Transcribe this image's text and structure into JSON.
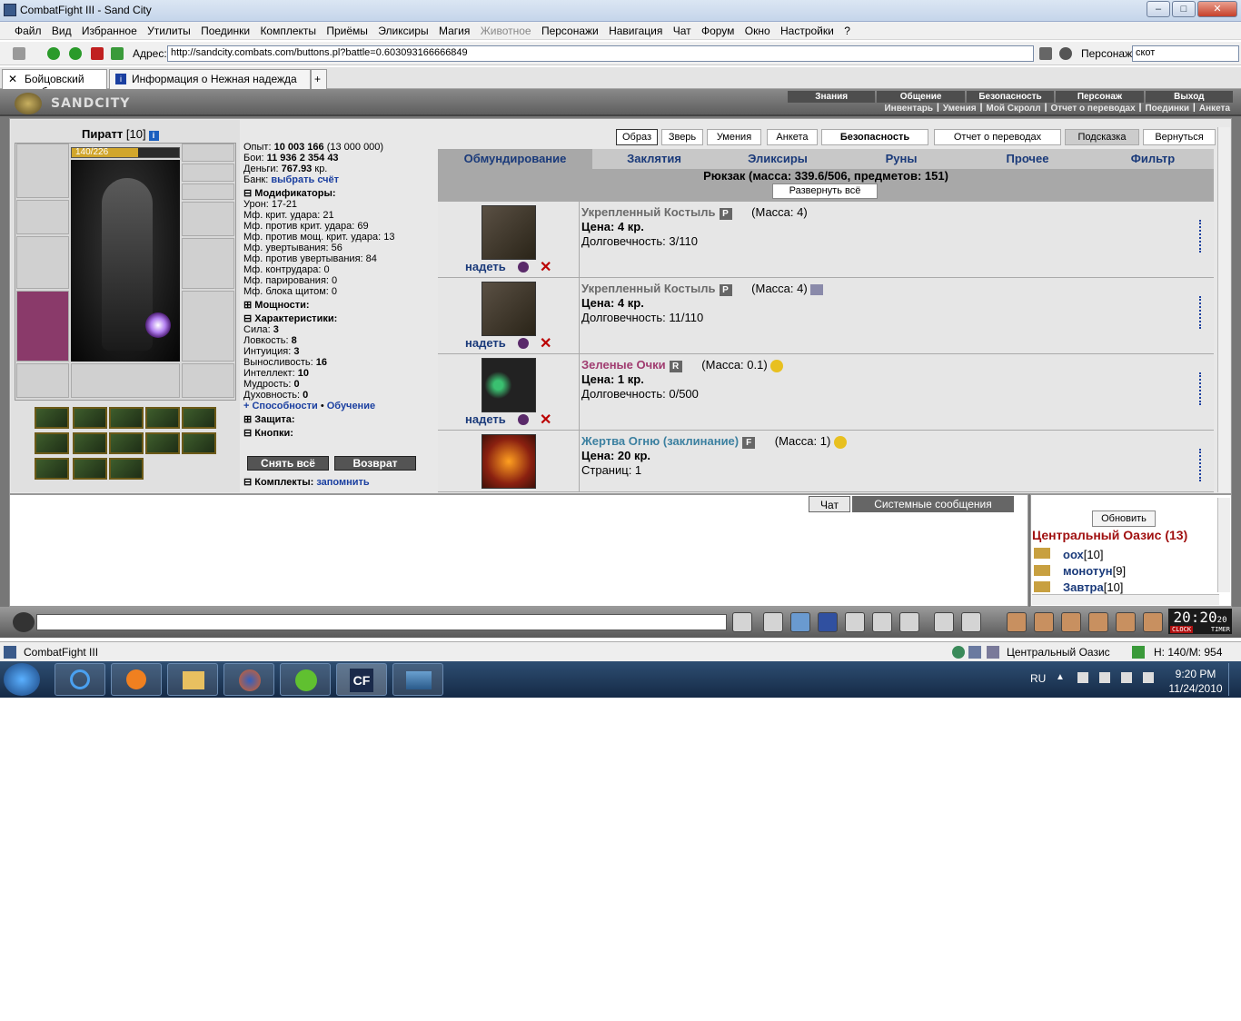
{
  "window": {
    "title": "CombatFight III - Sand City"
  },
  "menu": [
    "Файл",
    "Вид",
    "Избранное",
    "Утилиты",
    "Поединки",
    "Комплекты",
    "Приёмы",
    "Эликсиры",
    "Магия",
    "Животное",
    "Персонажи",
    "Навигация",
    "Чат",
    "Форум",
    "Окно",
    "Настройки",
    "?"
  ],
  "address": {
    "label": "Адрес:",
    "url": "http://sandcity.combats.com/buttons.pl?battle=0.603093166666849",
    "persona_label": "Персонаж:",
    "persona_value": "скот"
  },
  "tabs": [
    {
      "label": "Бойцовский клуб"
    },
    {
      "label": "Информация о Нежная надежда"
    }
  ],
  "header": {
    "logo": "SANDCITY",
    "nav_top": [
      "Знания",
      "Общение",
      "Безопасность",
      "Персонаж",
      "Выход"
    ],
    "nav_bottom": [
      "Инвентарь",
      "Умения",
      "Мой Скролл",
      "Отчет о переводах",
      "Поединки",
      "Анкета"
    ]
  },
  "character": {
    "name": "Пиратт",
    "level": "[10]",
    "hp": "140/226",
    "hp_fraction": 0.62
  },
  "stats": {
    "exp_label": "Опыт:",
    "exp_value": "10 003 166",
    "exp_next": "(13 000 000)",
    "fights_label": "Бои:",
    "wins": "11 936",
    "losses": "2 354",
    "draws": "43",
    "money_label": "Деньги:",
    "money_value": "767.93",
    "money_unit": "кр.",
    "bank_label": "Банк:",
    "bank_link": "выбрать счёт",
    "modifiers_title": "Модификаторы:",
    "modifiers": [
      "Урон: 17-21",
      "Мф. крит. удара: 21",
      "Мф. против крит. удара: 69",
      "Мф. против мощ. крит. удара: 13",
      "Мф. увертывания: 56",
      "Мф. против увертывания: 84",
      "Мф. контрудара: 0",
      "Мф. парирования: 0",
      "Мф. блока щитом: 0"
    ],
    "powers_title": "Мощности:",
    "chars_title": "Характеристики:",
    "chars": [
      {
        "label": "Сила:",
        "value": "3"
      },
      {
        "label": "Ловкость:",
        "value": "8"
      },
      {
        "label": "Интуиция:",
        "value": "3"
      },
      {
        "label": "Выносливость:",
        "value": "16"
      },
      {
        "label": "Интеллект:",
        "value": "10"
      },
      {
        "label": "Мудрость:",
        "value": "0"
      },
      {
        "label": "Духовность:",
        "value": "0"
      }
    ],
    "abilities_link": "+ Способности",
    "training_link": "Обучение",
    "protection_title": "Защита:",
    "buttons_title": "Кнопки:",
    "btn_remove_all": "Снять всё",
    "btn_return": "Возврат",
    "sets_title": "Комплекты:",
    "sets_link": "запомнить"
  },
  "top_buttons": [
    "Образ",
    "Зверь",
    "Умения",
    "Анкета",
    "Безопасность",
    "Отчет о переводах",
    "Подсказка",
    "Вернуться"
  ],
  "inventory_tabs": [
    "Обмундирование",
    "Заклятия",
    "Эликсиры",
    "Руны",
    "Прочее",
    "Фильтр"
  ],
  "backpack": {
    "title": "Рюкзак (масса: 339.6/506, предметов: 151)",
    "expand": "Развернуть всё"
  },
  "items": [
    {
      "name": "Укрепленный Костыль",
      "badge": "P",
      "mass": "(Масса: 4)",
      "price": "Цена: 4 кр.",
      "dur": "Долговечность: 3/110",
      "wear": "надеть",
      "color": "#6a6a6a"
    },
    {
      "name": "Укрепленный Костыль",
      "badge": "P",
      "mass": "(Масса: 4)",
      "price": "Цена: 4 кр.",
      "dur": "Долговечность: 11/110",
      "wear": "надеть",
      "color": "#6a6a6a"
    },
    {
      "name": "Зеленые Очки",
      "badge": "R",
      "mass": "(Масса: 0.1)",
      "price": "Цена: 1 кр.",
      "dur": "Долговечность: 0/500",
      "wear": "надеть",
      "color": "#a03c70"
    },
    {
      "name": "Жертва Огню (заклинание)",
      "badge": "F",
      "mass": "(Масса: 1)",
      "price": "Цена: 20 кр.",
      "dur": "Страниц: 1",
      "wear": "",
      "color": "#3c80a0"
    }
  ],
  "chat": {
    "tab_chat": "Чат",
    "tab_system": "Системные сообщения"
  },
  "location": {
    "refresh": "Обновить",
    "title": "Центральный Оазис (13)",
    "users": [
      {
        "name": "оох",
        "level": "[10]"
      },
      {
        "name": "монотун",
        "level": "[9]"
      },
      {
        "name": "Завтра",
        "level": "[10]"
      }
    ]
  },
  "clock": {
    "time": "20:20",
    "sec": "20",
    "clock_label": "CLOCK",
    "timer_label": "TIMER"
  },
  "status": {
    "app": "CombatFight III",
    "location": "Центральный Оазис",
    "hm": "H: 140/M: 954"
  },
  "taskbar": {
    "lang": "RU",
    "time": "9:20 PM",
    "date": "11/24/2010"
  },
  "colors": {
    "accent": "#1a3a7a",
    "hp": "#d1a62c",
    "location": "#a01010"
  }
}
